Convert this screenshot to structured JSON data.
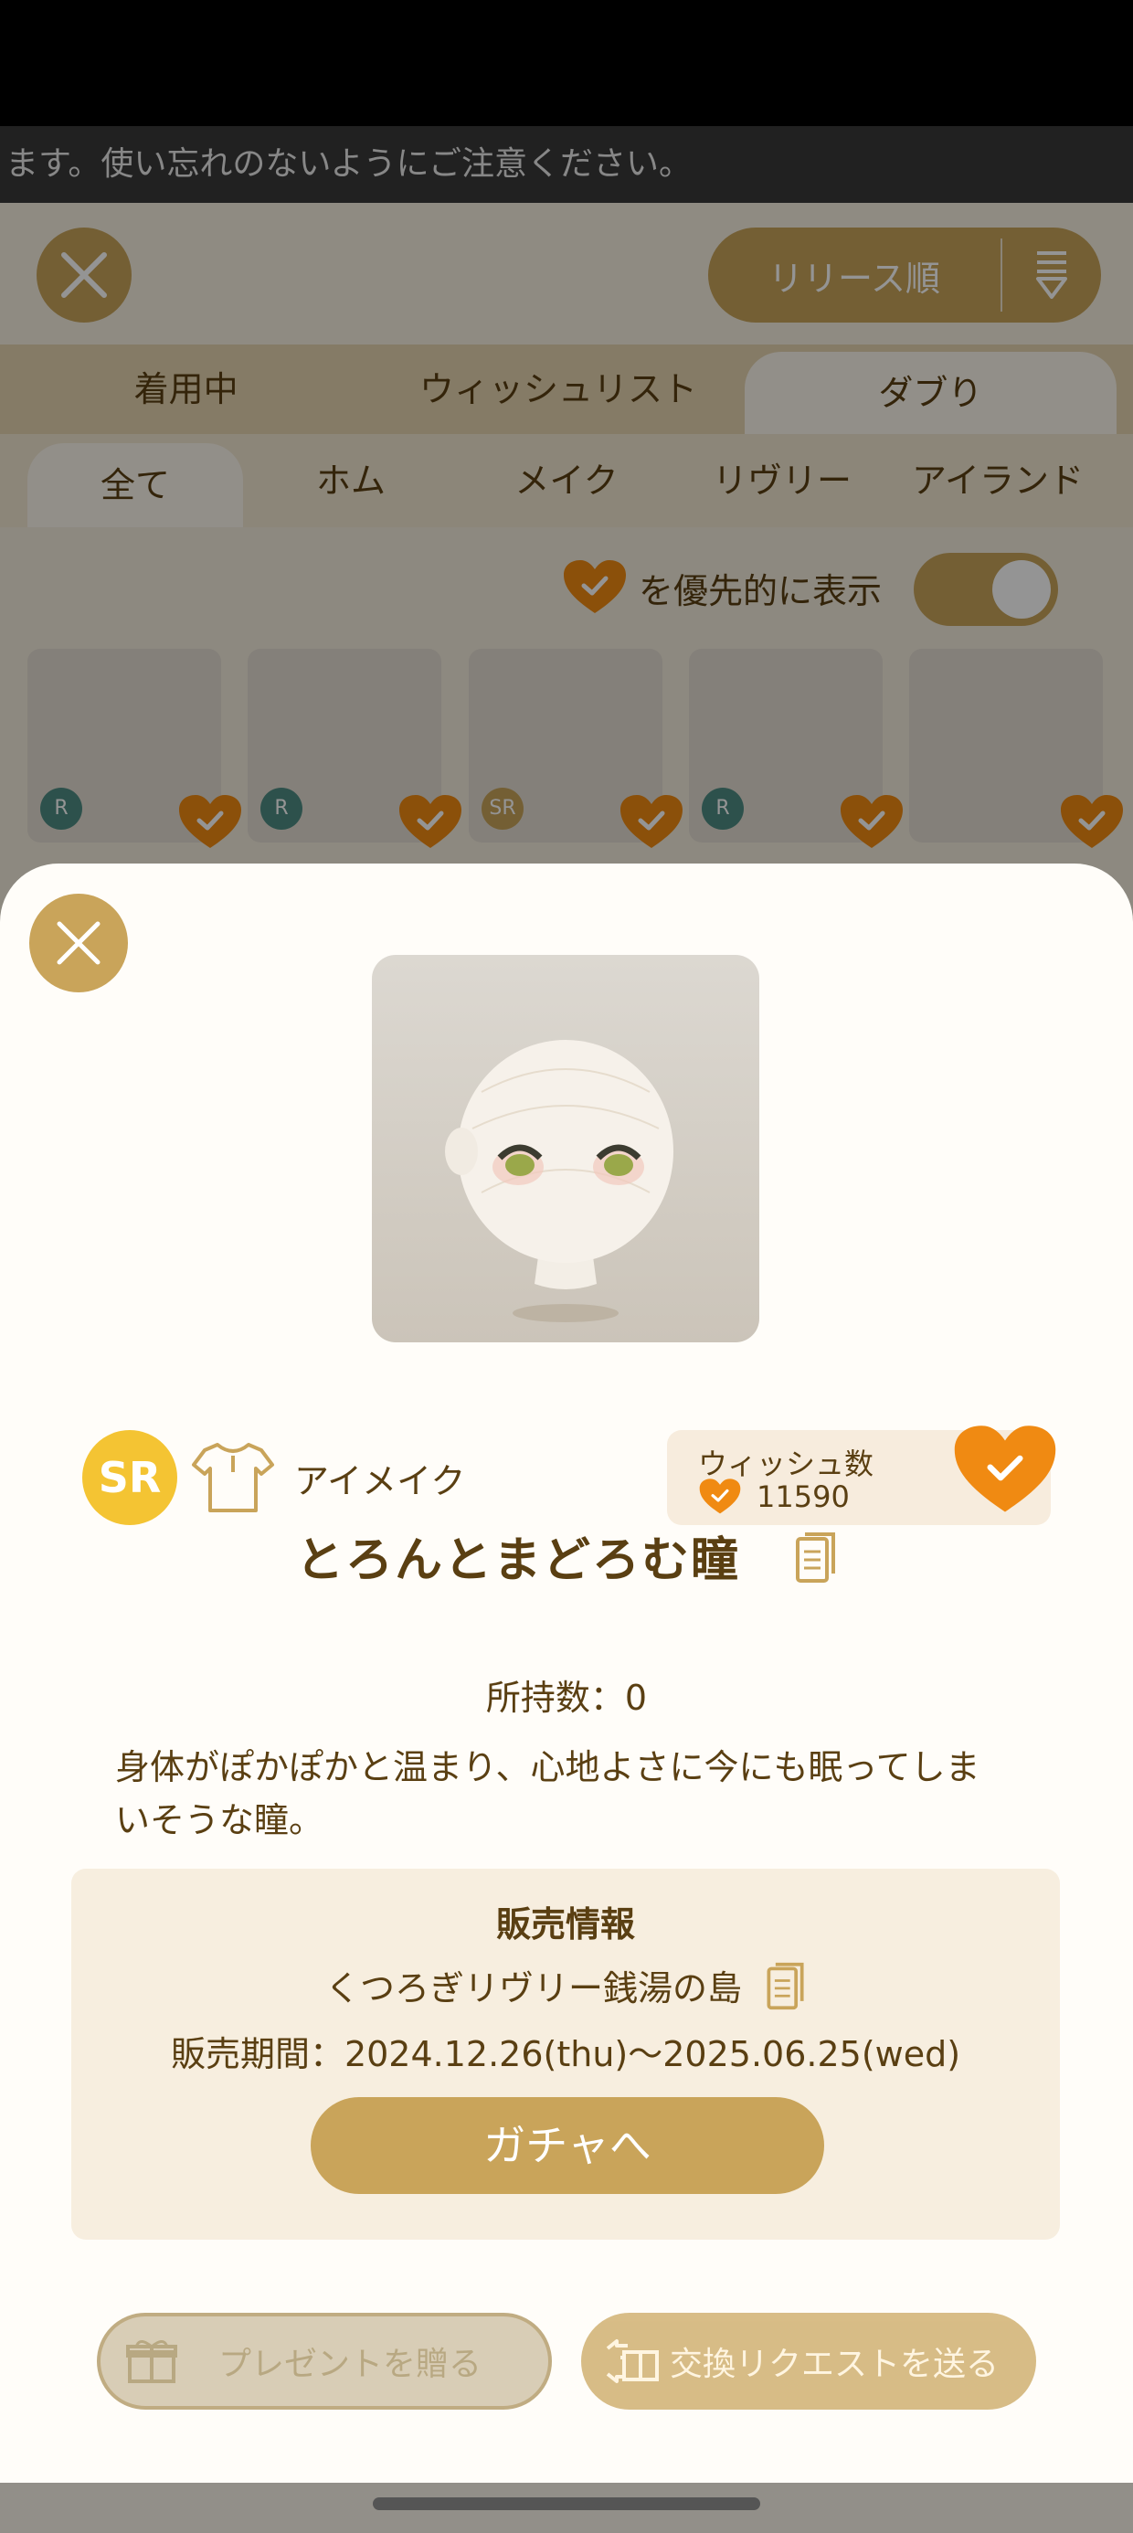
{
  "notice": {
    "text": "ます。使い忘れのないようにご注意ください。"
  },
  "header": {
    "sort_label": "リリース順"
  },
  "main_tabs": [
    {
      "label": "着用中"
    },
    {
      "label": "ウィッシュリスト"
    },
    {
      "label": "ダブり"
    }
  ],
  "sub_tabs": [
    {
      "label": "全て"
    },
    {
      "label": "ホム"
    },
    {
      "label": "メイク"
    },
    {
      "label": "リヴリー"
    },
    {
      "label": "アイランド"
    }
  ],
  "priority": {
    "label": "を優先的に表示"
  },
  "items": [
    {
      "rarity": "R"
    },
    {
      "rarity": "R"
    },
    {
      "rarity": "SR"
    },
    {
      "rarity": "R"
    },
    {
      "rarity": ""
    }
  ],
  "detail": {
    "rarity": "SR",
    "category": "アイメイク",
    "wish_title": "ウィッシュ数",
    "wish_count": "11590",
    "name": "とろんとまどろむ瞳",
    "owned": "所持数：0",
    "description": "身体がぽかぽかと温まり、心地よさに今にも眠ってしまいそうな瞳。",
    "sale_title": "販売情報",
    "sale_place": "くつろぎリヴリー銭湯の島",
    "sale_period": "販売期間：2024.12.26(thu)〜2025.06.25(wed)",
    "gacha_button": "ガチャへ",
    "gift_button": "プレゼントを贈る",
    "trade_button": "交換リクエストを送る"
  },
  "colors": {
    "accent_gold": "#c9a45a",
    "heart_orange": "#f08a12",
    "sr_yellow": "#f4c433",
    "text_brown": "#5a3f12"
  }
}
